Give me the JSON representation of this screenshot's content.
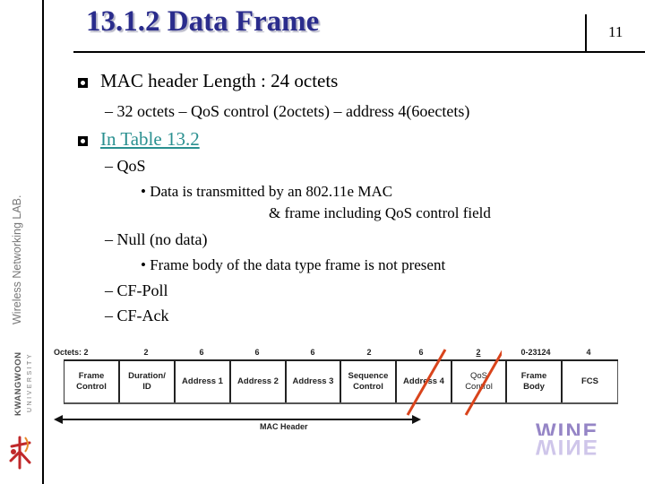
{
  "slide": {
    "title": "13.1.2 Data Frame",
    "page_number": "11"
  },
  "sidebar": {
    "lab_label": "Wireless Networking LAB.",
    "university_name": "KWANGWOON",
    "university_sub": "UNIVERSITY"
  },
  "content": {
    "items": [
      {
        "text": "MAC header Length : 24 octets"
      },
      {
        "text": "– 32 octets – QoS control (2octets) – address 4(6oectets)"
      },
      {
        "text": "In Table 13.2"
      },
      {
        "text": "– QoS"
      },
      {
        "text": "• Data is transmitted by an 802.11e MAC"
      },
      {
        "text": "& frame including QoS control field"
      },
      {
        "text": "– Null (no data)"
      },
      {
        "text": "• Frame body of the data type frame is not present"
      },
      {
        "text": "– CF-Poll"
      },
      {
        "text": "– CF-Ack"
      }
    ]
  },
  "diagram": {
    "octets_label": "Octets: 2",
    "fields": [
      {
        "name": "Frame\nControl",
        "line1": "Frame",
        "line2": "Control",
        "octets": "2"
      },
      {
        "name": "Duration/ID",
        "line1": "Duration/",
        "line2": "ID",
        "octets": "2"
      },
      {
        "name": "Address 1",
        "line1": "Address 1",
        "line2": "",
        "octets": "6"
      },
      {
        "name": "Address 2",
        "line1": "Address 2",
        "line2": "",
        "octets": "6"
      },
      {
        "name": "Address 3",
        "line1": "Address 3",
        "line2": "",
        "octets": "6"
      },
      {
        "name": "Sequence Control",
        "line1": "Sequence",
        "line2": "Control",
        "octets": "2"
      },
      {
        "name": "Address 4",
        "line1": "Address 4",
        "line2": "",
        "octets": "6",
        "struck": true
      },
      {
        "name": "QoS Control",
        "line1": "QoS",
        "line2": "Control",
        "octets": "2",
        "struck": true
      },
      {
        "name": "Frame Body",
        "line1": "Frame",
        "line2": "Body",
        "octets": "0-23124"
      },
      {
        "name": "FCS",
        "line1": "FCS",
        "line2": "",
        "octets": "4"
      }
    ],
    "mac_header_label": "MAC Header",
    "strike_color": "#d9441c"
  },
  "logo": {
    "text": "WINE",
    "color": "#8a78c0"
  }
}
